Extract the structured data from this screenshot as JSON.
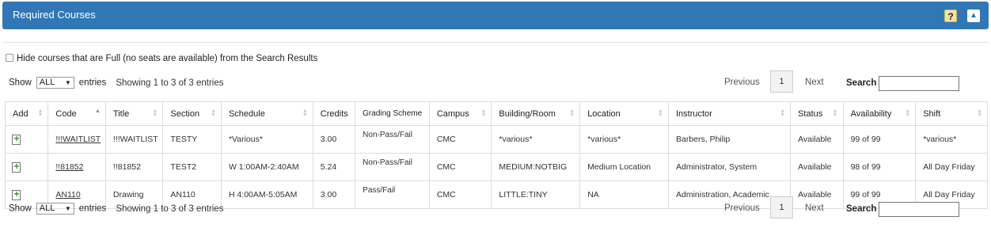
{
  "header": {
    "title": "Required Courses",
    "help_label": "?",
    "collapse_label": "^"
  },
  "hide_full_label": "Hide courses that are Full (no seats are available) from the Search Results",
  "controls": {
    "show_label": "Show",
    "entries_select": "ALL",
    "entries_label": "entries",
    "info": "Showing 1 to 3 of 3 entries",
    "previous": "Previous",
    "page": "1",
    "next": "Next",
    "search_label": "Search"
  },
  "table": {
    "columns": [
      "Add",
      "Code",
      "Title",
      "Section",
      "Schedule",
      "Credits",
      "Grading Scheme",
      "Campus",
      "Building/Room",
      "Location",
      "Instructor",
      "Status",
      "Availability",
      "Shift"
    ],
    "rows": [
      [
        "",
        "!!!WAITLIST",
        "!!!WAITLIST",
        "TESTY",
        "*Various*",
        "3.00",
        "Non-Pass/Fail",
        "CMC",
        "*various*",
        "*various*",
        "Barbers, Philip",
        "Available",
        "99 of 99",
        "*various*"
      ],
      [
        "",
        "!!81852",
        "!!81852",
        "TEST2",
        "W 1:00AM-2:40AM",
        "5.24",
        "Non-Pass/Fail",
        "CMC",
        "MEDIUM:NOTBIG",
        "Medium Location",
        "Administrator, System",
        "Available",
        "98 of 99",
        "All Day Friday"
      ],
      [
        "",
        "AN110",
        "Drawing",
        "AN110",
        "H 4:00AM-5:05AM",
        "3.00",
        "Pass/Fail",
        "CMC",
        "LITTLE:TINY",
        "NA",
        "Administration, Academic",
        "Available",
        "99 of 99",
        "All Day Friday"
      ]
    ]
  }
}
